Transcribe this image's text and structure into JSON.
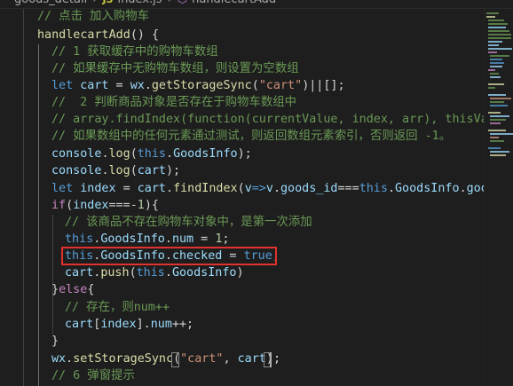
{
  "breadcrumb": {
    "folder": "goods_detail",
    "js_badge": "JS",
    "file": "index.js",
    "symbol": "handlecartAdd"
  },
  "code": {
    "line01": "// 点击 加入购物车",
    "line02_name": "handlecartAdd",
    "line02_rest": "() {",
    "line03": "// 1 获取缓存中的购物车数组",
    "line04": "// 如果缓存中无购物车数组，则设置为空数组",
    "line05": {
      "k": "let",
      "a": "cart",
      "b": " = ",
      "c": "wx",
      "d": ".",
      "e": "getStorageSync",
      "f": "(",
      "g": "\"cart\"",
      "h": ")||[];"
    },
    "line06": "//  2 判断商品对象是否存在于购物车数组中",
    "line07": "// array.findIndex(function(currentValue, index, arr), thisValue)",
    "line08": "// 如果数组中的任何元素通过测试，则返回数组元素索引，否则返回 -1。",
    "line09": {
      "a": "console",
      "b": ".",
      "c": "log",
      "d": "(",
      "e": "this",
      "f": ".",
      "g": "GoodsInfo",
      "h": ");"
    },
    "line10": {
      "a": "console",
      "b": ".",
      "c": "log",
      "d": "(",
      "e": "cart",
      "f": ");"
    },
    "line11": {
      "k": "let",
      "a": "index",
      "b": " = ",
      "c": "cart",
      "d": ".",
      "e": "findIndex",
      "f": "(",
      "g": "v",
      "h": "=>",
      "i": "v",
      "j": ".",
      "l": "goods_id",
      "m": "===",
      "n": "this",
      "o": ".",
      "p": "GoodsInfo",
      "q": ".",
      "r": "goods_id"
    },
    "line12": {
      "k": "if",
      "a": "(",
      "b": "index",
      "c": "===",
      "d": "-1",
      "e": "){"
    },
    "line13": "// 该商品不存在购物车对象中，是第一次添加",
    "line14": {
      "a": "this",
      "b": ".",
      "c": "GoodsInfo",
      "d": ".",
      "e": "num",
      "f": " = ",
      "g": "1",
      "h": ";"
    },
    "line15": {
      "a": "this",
      "b": ".",
      "c": "GoodsInfo",
      "d": ".",
      "e": "checked",
      "f": " = ",
      "g": "true",
      "h": ";"
    },
    "line16": {
      "a": "cart",
      "b": ".",
      "c": "push",
      "d": "(",
      "e": "this",
      "f": ".",
      "g": "GoodsInfo",
      "h": ")"
    },
    "line17": {
      "a": "}",
      "k": "else",
      "b": "{"
    },
    "line18": "// 存在，则num++",
    "line19": {
      "a": "cart",
      "b": "[",
      "c": "index",
      "d": "].",
      "e": "num",
      "f": "++;"
    },
    "line20": "}",
    "line21": {
      "a": "wx",
      "b": ".",
      "c": "setStorageSync",
      "d": "(",
      "e": "\"cart\"",
      "f": ", ",
      "g": "cart",
      "h": ")",
      "i": ";"
    },
    "line22": "// 6 弹窗提示"
  },
  "colors": {
    "background": "#1e1e1e",
    "comment": "#6a9955",
    "keyword": "#569cd6",
    "control_keyword": "#c586c0",
    "variable": "#9cdcfe",
    "function": "#dcdcaa",
    "string": "#ce9178",
    "number": "#b5cea8",
    "highlight_box": "#e0322f"
  }
}
